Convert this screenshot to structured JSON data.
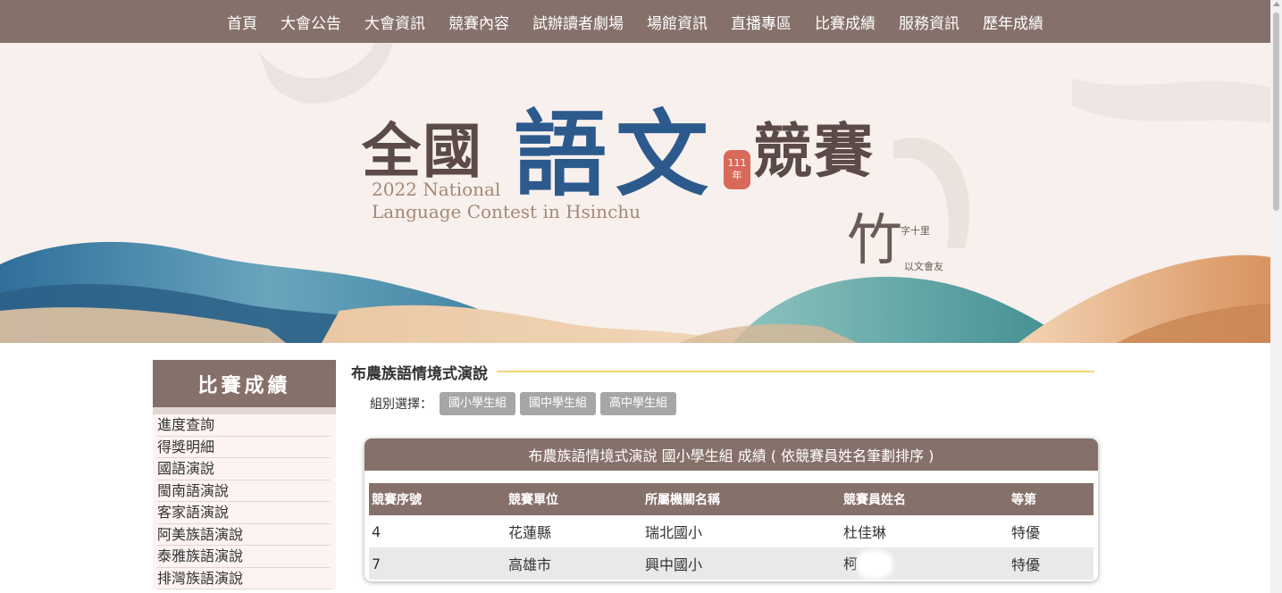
{
  "nav": {
    "items": [
      "首頁",
      "大會公告",
      "大會資訊",
      "競賽內容",
      "試辦讀者劇場",
      "場館資訊",
      "直播專區",
      "比賽成績",
      "服務資訊",
      "歷年成績"
    ]
  },
  "banner": {
    "title_part1": "全國",
    "title_part2": "語文",
    "title_part3": "競賽",
    "seal_text": "111年",
    "en_line1": "2022 National",
    "en_line2": "Language Contest in Hsinchu",
    "mark_char": "竹",
    "mark_sub1": "字十里",
    "mark_sub2": "以文會友"
  },
  "sidebar": {
    "title": "比賽成績",
    "items": [
      "進度查詢",
      "得獎明細",
      "國語演說",
      "閩南語演說",
      "客家語演說",
      "阿美族語演說",
      "泰雅族語演說",
      "排灣族語演說"
    ]
  },
  "main": {
    "section_title": "布農族語情境式演說",
    "group_label": "組別選擇：",
    "group_buttons": [
      "國小學生組",
      "國中學生組",
      "高中學生組"
    ],
    "card_title": "布農族語情境式演說 國小學生組 成績 ( 依競賽員姓名筆劃排序 )",
    "table": {
      "headers": [
        "競賽序號",
        "競賽單位",
        "所屬機關名稱",
        "競賽員姓名",
        "等第"
      ],
      "rows": [
        [
          "4",
          "花蓮縣",
          "瑞北國小",
          "杜佳琳",
          "特優"
        ],
        [
          "7",
          "高雄市",
          "興中國小",
          "柯",
          "特優"
        ]
      ]
    }
  },
  "colors": {
    "nav_bg": "#86706a",
    "accent_line": "#f1d67a",
    "title_blue": "#2c5a8c",
    "seal_red": "#d86a5a"
  }
}
